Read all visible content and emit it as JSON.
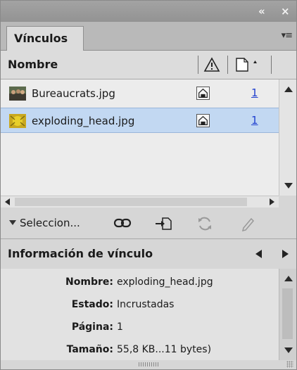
{
  "panel": {
    "tab_label": "Vínculos",
    "menu_icon": "panel-menu-icon",
    "collapse_icon": "double-chevron-icon",
    "close_icon": "close-icon",
    "accent": "#c2d8f2"
  },
  "columns": {
    "name": "Nombre",
    "status_icon": "warning-triangle-icon",
    "page_icon": "page-icon"
  },
  "links": [
    {
      "name": "Bureaucrats.jpg",
      "status": "embedded-icon",
      "page": "1",
      "selected": false
    },
    {
      "name": "exploding_head.jpg",
      "status": "embedded-icon",
      "page": "1",
      "selected": true
    }
  ],
  "toolbar": {
    "selection_label": "Seleccion...",
    "icons": [
      "relink-icon",
      "go-to-link-icon",
      "update-link-icon",
      "edit-original-icon"
    ]
  },
  "info": {
    "title": "Información de vínculo",
    "rows": [
      {
        "label": "Nombre:",
        "value": "exploding_head.jpg"
      },
      {
        "label": "Estado:",
        "value": "Incrustadas"
      },
      {
        "label": "Página:",
        "value": "1"
      },
      {
        "label": "Tamaño:",
        "value": "55,8 KB...11 bytes)"
      }
    ]
  }
}
